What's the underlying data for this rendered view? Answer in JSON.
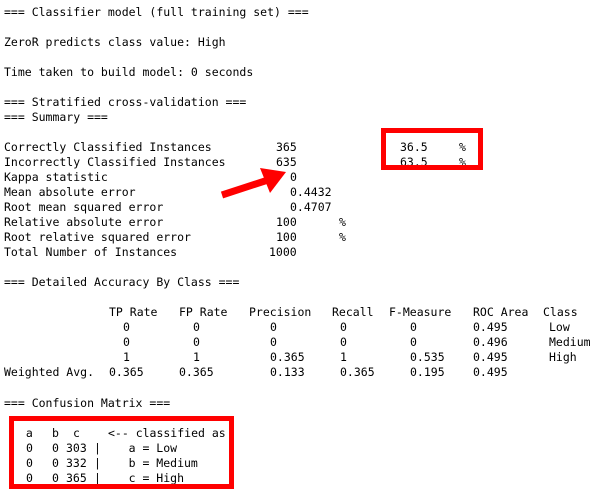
{
  "colors": {
    "highlight": "#ff0000",
    "text": "#000000",
    "background": "#ffffff"
  },
  "header": {
    "classifier_title": "=== Classifier model (full training set) ===",
    "zeror_line": "ZeroR predicts class value: High",
    "time_line": "Time taken to build model: 0 seconds"
  },
  "cv": {
    "title": "=== Stratified cross-validation ===",
    "summary_title": "=== Summary ==="
  },
  "summary": [
    {
      "label": "Correctly Classified Instances",
      "value": "365",
      "pct": "36.5",
      "unit": "%"
    },
    {
      "label": "Incorrectly Classified Instances",
      "value": "635",
      "pct": "63.5",
      "unit": "%"
    },
    {
      "label": "Kappa statistic",
      "value": "0"
    },
    {
      "label": "Mean absolute error",
      "value": "0.4432"
    },
    {
      "label": "Root mean squared error",
      "value": "0.4707"
    },
    {
      "label": "Relative absolute error",
      "value": "100",
      "unit": "%"
    },
    {
      "label": "Root relative squared error",
      "value": "100",
      "unit": "%"
    },
    {
      "label": "Total Number of Instances",
      "value": "1000"
    }
  ],
  "accuracy": {
    "title": "=== Detailed Accuracy By Class ===",
    "headers": [
      "TP Rate",
      "FP Rate",
      "Precision",
      "Recall",
      "F-Measure",
      "ROC Area",
      "Class"
    ],
    "rows": [
      {
        "label": "",
        "cells": [
          "0",
          "0",
          "0",
          "0",
          "0",
          "0.495",
          "Low"
        ]
      },
      {
        "label": "",
        "cells": [
          "0",
          "0",
          "0",
          "0",
          "0",
          "0.496",
          "Medium"
        ]
      },
      {
        "label": "",
        "cells": [
          "1",
          "1",
          "0.365",
          "1",
          "0.535",
          "0.495",
          "High"
        ]
      },
      {
        "label": "Weighted Avg.",
        "cells": [
          "0.365",
          "0.365",
          "0.133",
          "0.365",
          "0.195",
          "0.495",
          ""
        ]
      }
    ]
  },
  "confusion": {
    "title": "=== Confusion Matrix ===",
    "header": [
      " a",
      "b",
      "c",
      "<-- classified as"
    ],
    "rows": [
      {
        "a": "0",
        "b": "0",
        "c": "303",
        "label": "|    a = Low"
      },
      {
        "a": "0",
        "b": "0",
        "c": "332",
        "label": "|    b = Medium"
      },
      {
        "a": "0",
        "b": "0",
        "c": "365",
        "label": "|    c = High"
      }
    ]
  }
}
